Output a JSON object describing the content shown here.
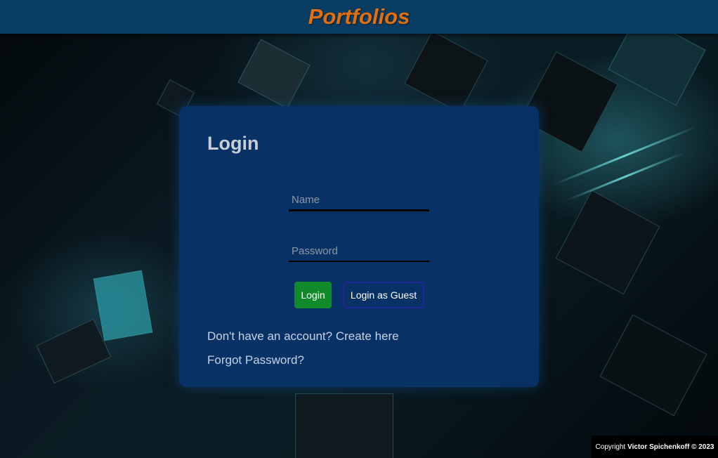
{
  "header": {
    "brand": "Portfolios"
  },
  "login": {
    "title": "Login",
    "name_placeholder": "Name",
    "password_placeholder": "Password",
    "login_button": "Login",
    "guest_button": "Login as Guest",
    "create_account_link": "Don't have an account? Create here",
    "forgot_password_link": "Forgot Password?"
  },
  "footer": {
    "prefix": "Copyright ",
    "owner": "Victor Spichenkoff © 2023"
  },
  "colors": {
    "header_bg": "#0a3d63",
    "brand": "#e0700f",
    "card_bg": "#083166",
    "login_button": "#118a2a",
    "guest_button_border": "#23239a"
  }
}
